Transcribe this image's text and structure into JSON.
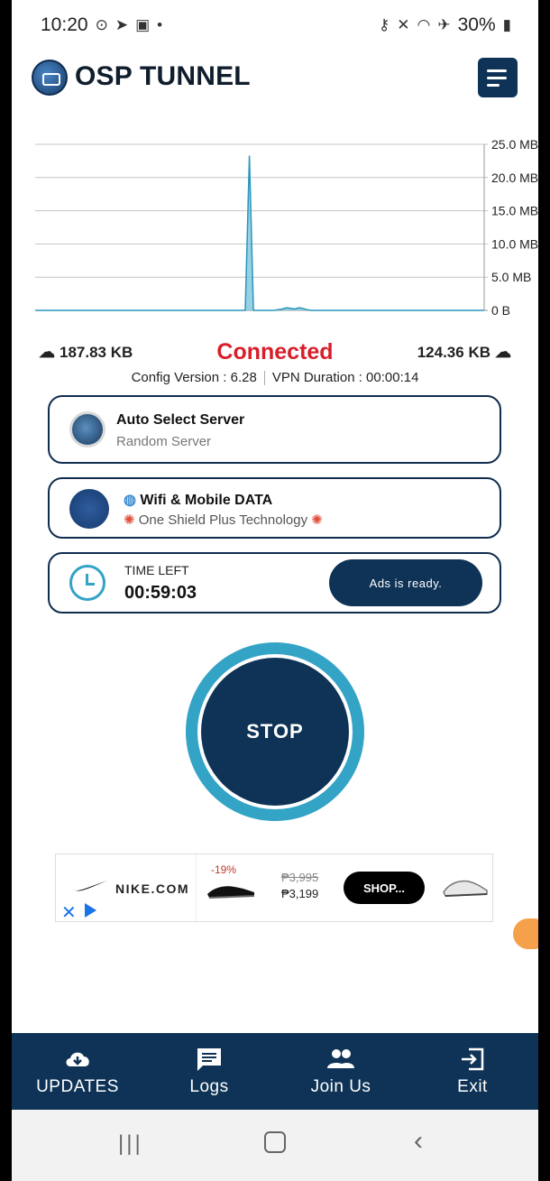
{
  "status_bar": {
    "time": "10:20",
    "battery": "30%"
  },
  "app": {
    "title": "OSP TUNNEL"
  },
  "chart_data": {
    "type": "area",
    "y_tick_labels": [
      "25.0 MB",
      "20.0 MB",
      "15.0 MB",
      "10.0 MB",
      "5.0 MB",
      "0 B"
    ],
    "ylim": [
      0,
      25
    ],
    "y_unit": "MB",
    "series": [
      {
        "values": [
          0,
          0,
          0,
          0,
          0,
          0,
          0,
          0,
          0,
          0,
          0,
          0,
          0,
          0,
          0,
          0,
          0,
          0,
          0,
          0,
          0,
          0,
          0,
          0,
          0,
          0,
          0,
          0,
          0,
          0,
          0,
          0,
          0,
          0,
          0,
          0,
          0,
          0,
          0,
          0,
          0,
          0,
          0,
          0,
          0,
          0,
          0,
          0,
          0,
          0,
          0,
          0,
          23.3,
          0,
          0,
          0,
          0,
          0,
          0,
          0.1,
          0.2,
          0.4,
          0.3,
          0.2,
          0.4,
          0.3,
          0.1,
          0,
          0,
          0,
          0,
          0,
          0,
          0,
          0,
          0,
          0,
          0,
          0,
          0,
          0,
          0,
          0,
          0,
          0,
          0,
          0,
          0,
          0,
          0,
          0,
          0,
          0,
          0,
          0,
          0,
          0,
          0,
          0,
          0,
          0,
          0,
          0,
          0,
          0,
          0,
          0,
          0,
          0,
          0
        ]
      }
    ],
    "colors": {
      "fill": "#7ec6dc",
      "line": "#2a96bd"
    },
    "grid": true
  },
  "stats": {
    "download": "187.83 KB",
    "upload": "124.36 KB",
    "status": "Connected",
    "status_color": "#d91e2a"
  },
  "config": {
    "version": "Config Version : 6.28",
    "duration": "VPN Duration : 00:00:14"
  },
  "server_card": {
    "title": "Auto Select Server",
    "subtitle": "Random Server",
    "icon": "globe-icon"
  },
  "network_card": {
    "title": "Wifi & Mobile DATA",
    "subtitle": "One Shield Plus Technology",
    "icon": "file-icon",
    "title_icon": "globe-emoji",
    "badge_icon": "anger-emoji"
  },
  "time_card": {
    "label": "TIME LEFT",
    "value": "00:59:03",
    "ads_button": "Ads is ready.",
    "icon": "clock-icon"
  },
  "stop_button": {
    "label": "STOP"
  },
  "ad_banner": {
    "brand": "NIKE.COM",
    "discount": "-19%",
    "old_price": "₱3,995",
    "new_price": "₱3,199",
    "cta": "SHOP..."
  },
  "bottom_nav": [
    {
      "label": "UPDATES",
      "icon": "cloud-download-icon"
    },
    {
      "label": "Logs",
      "icon": "message-icon"
    },
    {
      "label": "Join Us",
      "icon": "group-icon"
    },
    {
      "label": "Exit",
      "icon": "exit-icon"
    }
  ],
  "colors": {
    "primary": "#0e3356",
    "accent": "#33a3c6",
    "danger": "#d91e2a"
  }
}
